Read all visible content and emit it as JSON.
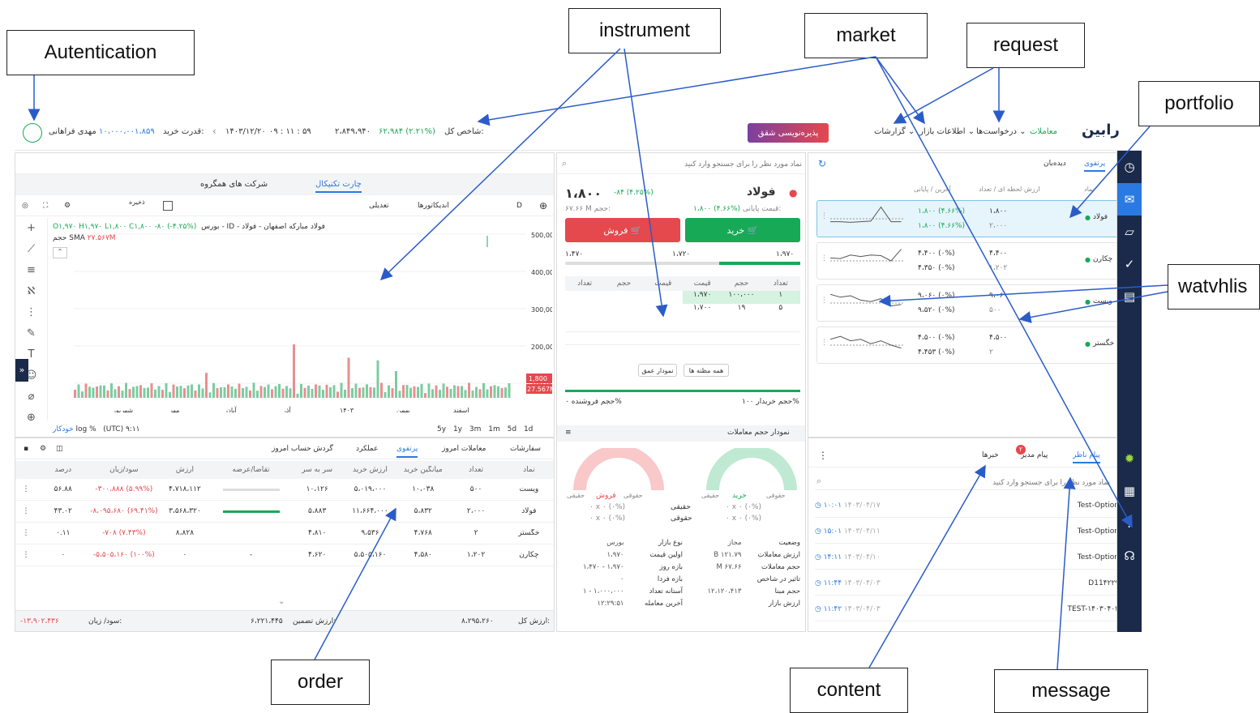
{
  "callouts": {
    "authentication": "Autentication",
    "instrument": "instrument",
    "market": "market",
    "request": "request",
    "portfolio": "portfolio",
    "watchlist": "watvhlis",
    "order": "order",
    "content": "content",
    "message": "message"
  },
  "topbar": {
    "logo": "رابین",
    "nav": [
      "معاملات",
      "درخواست‌ها",
      "اطلاعات بازار",
      "گزارشات"
    ],
    "promo": "پذیره‌نویسی شقق",
    "index_label": "شاخص کل:",
    "index_value": "۲،۸۴۹،۹۴۰",
    "index_change": "۶۲،۹۸۴ (۲.۲۱%)",
    "time": "۰۹ : ۱۱ : ۵۹",
    "date": "۱۴۰۳/۱۲/۲۰",
    "power_label": "قدرت خرید:",
    "power_value": "۱۰،۰۰۰،۰۰۱،۸۵۹",
    "user": "مهدی فراهانی"
  },
  "chart": {
    "tab_active": "چارت تکنیکال",
    "tab_other": "شرکت های همگروه",
    "toolbar": {
      "interval": "D",
      "indicators": "اندیکاتورها",
      "adjusted": "تعدیلی",
      "save": "ذخیره",
      "save_sub": "ذخیره"
    },
    "legend": "بورس - ID - فولاد مبارکه اصفهان - فولاد",
    "ohlc": "O۱,۹۷۰ H۱,۹۷۰ L۱,۸۰۰ C۱,۸۰۰ -۸۰ (-۴.۲۵%)",
    "volume_label": "حجم SMA",
    "volume_value": "۲۷.۵۶۷M",
    "y_ticks": [
      "500,000",
      "400,000",
      "300,000",
      "200,000",
      "100,000"
    ],
    "price_badge": "1,800",
    "vol_badge": "27.567M",
    "x_ticks": [
      "اسفند",
      "بهمن",
      "۱۴۰۳",
      "آذر",
      "آبان",
      "مهر",
      "شهریور"
    ],
    "ranges": [
      "1d",
      "5d",
      "1m",
      "3m",
      "1y",
      "5y"
    ],
    "tz": "(UTC) ۹:۱۱",
    "scale_opts": [
      "%",
      "log",
      "خودکار"
    ]
  },
  "portfolio_table": {
    "tabs": [
      "سفارشات",
      "معاملات امروز",
      "پرتفوی",
      "عملکرد",
      "گردش حساب امروز"
    ],
    "active": "پرتفوی",
    "headers": [
      "نماد",
      "تعداد",
      "میانگین خرید",
      "ارزش خرید",
      "سر به سر",
      "تقاضا/عرضه",
      "ارزش",
      "سود/زیان",
      "درصد"
    ],
    "rows": [
      [
        "ویست",
        "۵۰۰",
        "۱۰،۰۳۸",
        "۵،۰۱۹،۰۰۰",
        "۱۰،۱۲۶",
        "",
        "۴،۷۱۸،۱۱۲",
        "-۳۰۰،۸۸۸ (۵.۹۹%)",
        "۵۶.۸۸"
      ],
      [
        "فولاد",
        "۲،۰۰۰",
        "۵،۸۳۲",
        "۱۱،۶۶۴،۰۰۰",
        "۵،۸۸۳",
        "",
        "۳،۵۶۸،۳۲۰",
        "-۸،۰۹۵،۶۸۰ (۶۹.۴۱%)",
        "۴۳.۰۲"
      ],
      [
        "خگستر",
        "۲",
        "۴،۷۶۸",
        "۹،۵۳۶",
        "۴،۸۱۰",
        "",
        "۸،۸۲۸",
        "-۷۰۸ (۷.۴۳%)",
        "۰.۱۱"
      ],
      [
        "چکارن",
        "۱،۲۰۲",
        "۴،۵۸۰",
        "۵،۵۰۵،۱۶۰",
        "۴،۶۲۰",
        "-",
        "۰",
        "-۵،۵۰۵،۱۶۰ (۱۰۰%)",
        "۰"
      ]
    ],
    "total_value_label": "ارزش کل:",
    "total_value": "۸،۲۹۵،۲۶۰",
    "collateral_label": "ارزش تضمین:",
    "collateral": "۶،۲۲۱،۴۴۵",
    "pl_label": "سود/ زیان:",
    "pl_value": "-۱۳،۹۰۲،۴۳۶"
  },
  "order": {
    "search_placeholder": "نماد مورد نظر را برای جستجو وارد کنید",
    "symbol": "فولاد",
    "price": "۱،۸۰۰",
    "change": "-۸۴ (۴.۲۵%)",
    "close_label": "قیمت پایانی:",
    "close_value": "۱،۸۰۰ (۴.۶۶%)",
    "vol_label": "حجم:",
    "vol_value": "۶۷.۶۶ M",
    "buy": "خرید",
    "sell": "فروش",
    "range": [
      "۱،۹۷۰",
      "۱،۷۲۰",
      "۱،۴۷۰"
    ],
    "depth_headers": [
      "تعداد",
      "حجم",
      "قیمت",
      "قیمت",
      "حجم",
      "تعداد"
    ],
    "depth_rows": [
      [
        "۱",
        "۱۰۰،۰۰۰",
        "۱،۹۷۰",
        "",
        "",
        ""
      ],
      [
        "۵",
        "۱۹",
        "۱،۷۰۰",
        "",
        "",
        ""
      ]
    ],
    "btn_all": "همه مظنه ها",
    "btn_depth": "نمودار عمق",
    "buyer_vol": "حجم خریدار ۱۰۰%",
    "seller_vol": "حجم فروشنده ۰%",
    "volume_chart_title": "نمودار حجم معاملات",
    "gauge_buy": "خرید",
    "gauge_sell": "فروش",
    "real": "حقیقی",
    "legal": "حقوقی",
    "zero": "۰ x ۰ (۰%)",
    "info": [
      [
        "وضعیت",
        "مجاز",
        "نوع بازار",
        "بورس"
      ],
      [
        "ارزش معاملات",
        "۱۲۱.۷۹ B",
        "اولین قیمت",
        "۱،۹۷۰"
      ],
      [
        "حجم معاملات",
        "۶۷.۶۶ M",
        "بازه روز",
        "۱،۹۷۰ - ۱،۴۷۰"
      ],
      [
        "تاثیر در شاخص",
        "",
        "بازه فردا",
        "۰"
      ],
      [
        "حجم مبنا",
        "۱۲،۱۲۰،۴۱۳",
        "آستانه تعداد",
        "۱،۰۰۰،۰۰۰ - ۱"
      ],
      [
        "ارزش بازار",
        "",
        "آخرین معامله",
        "۱۲:۲۹:۵۱"
      ]
    ]
  },
  "watchlist": {
    "tabs": [
      "پرتفوی",
      "دیده‌بان"
    ],
    "headers": [
      "نماد",
      "ارزش لحظه ای / تعداد",
      "آخرین / پایانی"
    ],
    "items": [
      {
        "name": "فولاد",
        "last": "۱،۸۰۰ (۴.۶۶%)",
        "close": "۱،۸۰۰ (۴.۶۶%)",
        "qty": "۱،۸۰۰",
        "count": "۲،۰۰۰"
      },
      {
        "name": "چکارن",
        "last": "۴،۴۰۰ (۰%)",
        "close": "۴،۳۵۰ (۰%)",
        "qty": "۴،۴۰۰",
        "count": "۱،۲۰۲"
      },
      {
        "name": "ویست",
        "last": "۹،۰۶۰ (۰%)",
        "close": "۹،۵۲۰ (۰%)",
        "qty": "۹،۰۶۰",
        "count": "۵۰۰"
      },
      {
        "name": "خگستر",
        "last": "۴،۵۰۰ (۰%)",
        "close": "۴،۴۵۳ (۰%)",
        "qty": "۴،۵۰۰",
        "count": "۲"
      }
    ]
  },
  "messages": {
    "tabs": [
      "پیام ناظر",
      "پیام مدیر",
      "خبرها"
    ],
    "badge": "۲",
    "search_placeholder": "نماد مورد نظر را برای جستجو وارد کنید",
    "rows": [
      [
        "Test-Option",
        "۱۴۰۳/۰۴/۱۷",
        "۱۰:۰۱"
      ],
      [
        "Test-Option",
        "۱۴۰۳/۰۴/۱۱",
        "۱۵:۰۱"
      ],
      [
        "Test-Option",
        "۱۴۰۳/۰۴/۱۰",
        "۱۴:۱۱"
      ],
      [
        "D11۴۲۲۹",
        "۱۴۰۳/۰۴/۰۳",
        "۱۱:۴۴"
      ],
      [
        "TEST-۱۴۰۳۰۴۰۳",
        "۱۴۰۳/۰۴/۰۳",
        "۱۱:۴۲"
      ]
    ]
  },
  "colors": {
    "green": "#18a957",
    "red": "#e5484d",
    "accent": "#2a7ae2",
    "sidebar": "#1b2a4a"
  }
}
